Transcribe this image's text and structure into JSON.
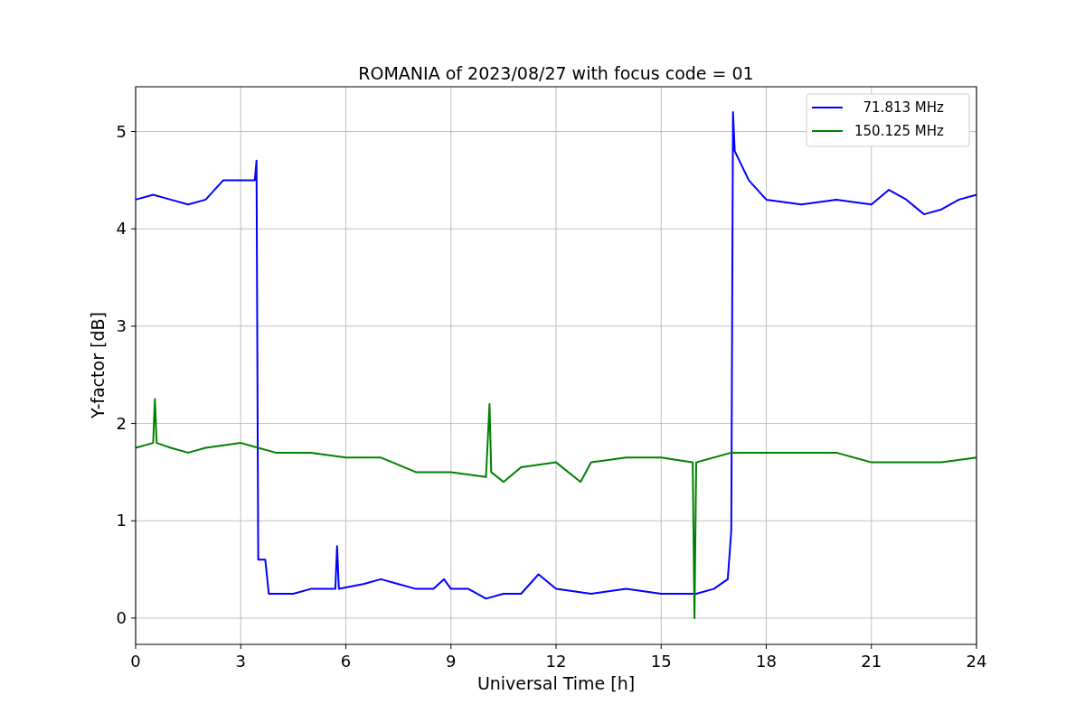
{
  "chart_data": {
    "type": "line",
    "title": "ROMANIA of 2023/08/27 with focus code = 01",
    "xlabel": "Universal Time [h]",
    "ylabel": "Y-factor [dB]",
    "xlim": [
      0,
      24
    ],
    "ylim": [
      -0.27,
      5.46
    ],
    "xticks": [
      0,
      3,
      6,
      9,
      12,
      15,
      18,
      21,
      24
    ],
    "yticks": [
      0,
      1,
      2,
      3,
      4,
      5
    ],
    "grid": true,
    "legend": "upper right",
    "series": [
      {
        "name": "  71.813 MHz",
        "color": "#0000ff",
        "x": [
          0,
          0.5,
          1,
          1.5,
          2,
          2.5,
          3,
          3.4,
          3.45,
          3.5,
          3.7,
          3.8,
          4.5,
          5,
          5.7,
          5.75,
          5.8,
          6.5,
          7,
          7.5,
          8,
          8.5,
          8.8,
          9,
          9.5,
          10,
          10.5,
          11,
          11.5,
          12,
          13,
          14,
          15,
          16,
          16.5,
          16.9,
          17,
          17.05,
          17.1,
          17.5,
          18,
          19,
          20,
          21,
          21.5,
          22,
          22.5,
          23,
          23.5,
          24
        ],
        "values": [
          4.3,
          4.35,
          4.3,
          4.25,
          4.3,
          4.5,
          4.5,
          4.5,
          4.7,
          0.6,
          0.6,
          0.25,
          0.25,
          0.3,
          0.3,
          0.74,
          0.3,
          0.35,
          0.4,
          0.35,
          0.3,
          0.3,
          0.4,
          0.3,
          0.3,
          0.2,
          0.25,
          0.25,
          0.45,
          0.3,
          0.25,
          0.3,
          0.25,
          0.25,
          0.3,
          0.4,
          0.9,
          5.2,
          4.8,
          4.5,
          4.3,
          4.25,
          4.3,
          4.25,
          4.4,
          4.3,
          4.15,
          4.2,
          4.3,
          4.35
        ]
      },
      {
        "name": "150.125 MHz",
        "color": "#008000",
        "x": [
          0,
          0.5,
          0.55,
          0.6,
          1,
          1.5,
          2,
          3,
          3.5,
          4,
          5,
          6,
          7,
          8,
          9,
          10,
          10.1,
          10.15,
          10.5,
          11,
          12,
          12.7,
          13,
          14,
          15,
          15.9,
          15.95,
          16,
          17,
          18,
          19,
          20,
          21,
          22,
          23,
          24
        ],
        "values": [
          1.75,
          1.8,
          2.25,
          1.8,
          1.75,
          1.7,
          1.75,
          1.8,
          1.75,
          1.7,
          1.7,
          1.65,
          1.65,
          1.5,
          1.5,
          1.45,
          2.2,
          1.5,
          1.4,
          1.55,
          1.6,
          1.4,
          1.6,
          1.65,
          1.65,
          1.6,
          0,
          1.6,
          1.7,
          1.7,
          1.7,
          1.7,
          1.6,
          1.6,
          1.6,
          1.65
        ]
      }
    ]
  }
}
